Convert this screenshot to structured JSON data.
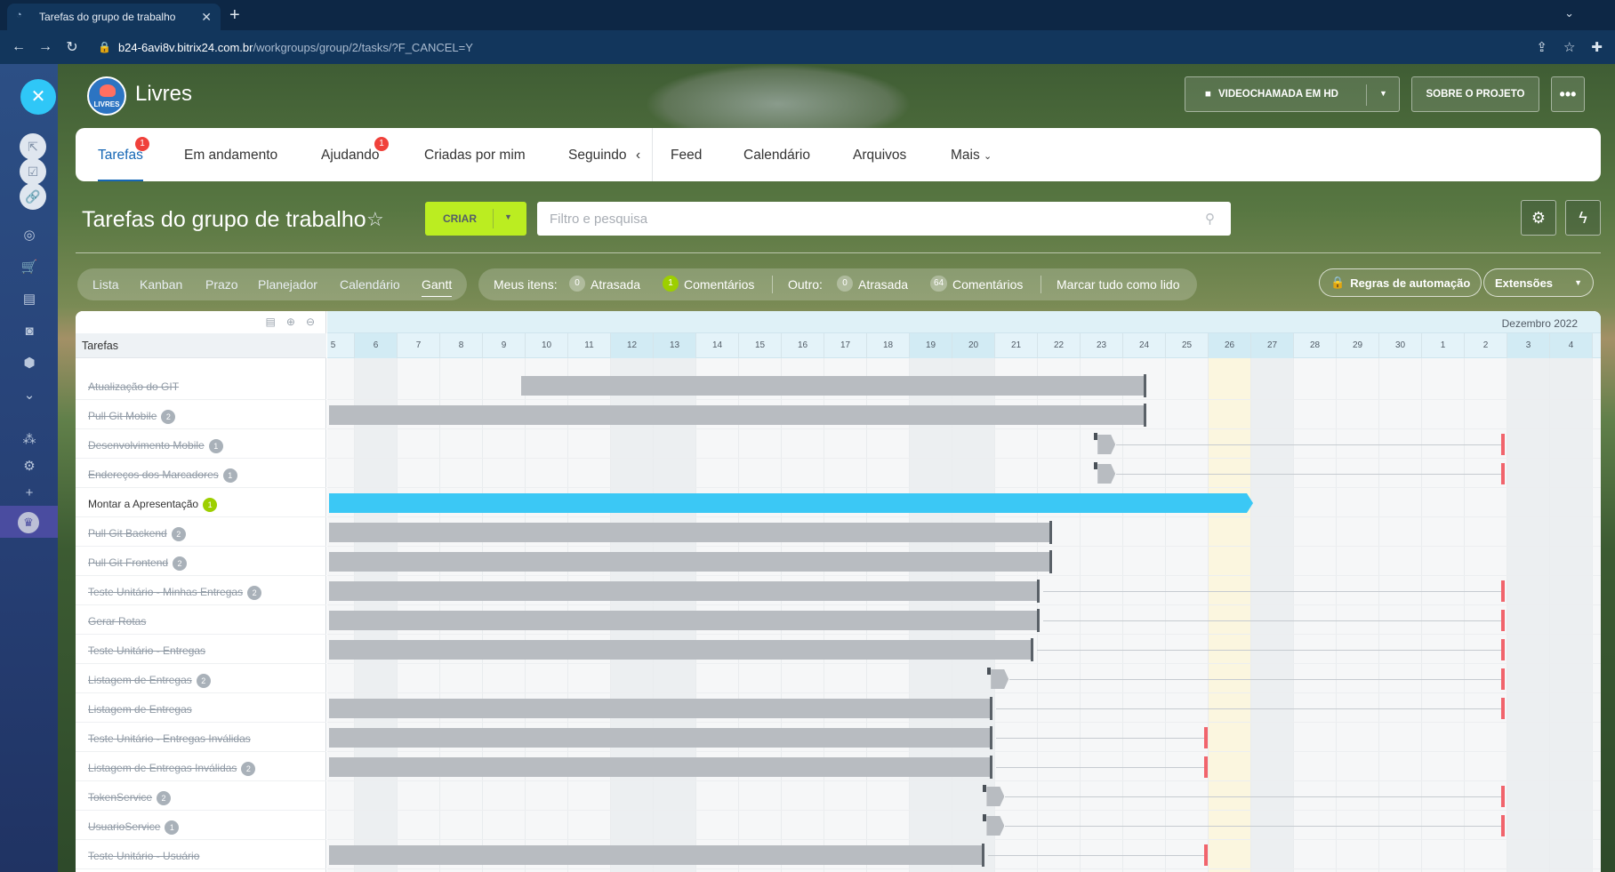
{
  "browser": {
    "tab_title": "Tarefas do grupo de trabalho",
    "url_host": "b24-6avi8v.bitrix24.com.br",
    "url_path": "/workgroups/group/2/tasks/?F_CANCEL=Y"
  },
  "group": {
    "logo_text": "LIVRES",
    "name": "Livres",
    "video_button": "VIDEOCHAMADA EM HD",
    "about_button": "SOBRE O PROJETO",
    "more_button": "•••"
  },
  "nav": {
    "items": [
      {
        "label": "Tarefas",
        "badge": "1"
      },
      {
        "label": "Em andamento"
      },
      {
        "label": "Ajudando",
        "badge": "1"
      },
      {
        "label": "Criadas por mim"
      },
      {
        "label": "Seguindo"
      },
      {
        "label": "Feed"
      },
      {
        "label": "Calendário"
      },
      {
        "label": "Arquivos"
      },
      {
        "label": "Mais"
      }
    ]
  },
  "toolbar": {
    "title": "Tarefas do grupo de trabalho",
    "create_label": "CRIAR",
    "search_placeholder": "Filtro e pesquisa"
  },
  "views": [
    "Lista",
    "Kanban",
    "Prazo",
    "Planejador",
    "Calendário",
    "Gantt"
  ],
  "counters": {
    "my_label": "Meus itens:",
    "my_overdue_count": "0",
    "overdue_label": "Atrasada",
    "my_comments_count": "1",
    "comments_label": "Comentários",
    "other_label": "Outro:",
    "other_overdue_count": "0",
    "other_overdue_label": "Atrasada",
    "other_comments_count": "64",
    "other_comments_label": "Comentários",
    "mark_all_read": "Marcar tudo como lido"
  },
  "right_buttons": {
    "automation": "Regras de automação",
    "extensions": "Extensões"
  },
  "gantt": {
    "column_header": "Tarefas",
    "month_label": "Dezembro 2022",
    "days": [
      "5",
      "6",
      "7",
      "8",
      "9",
      "10",
      "11",
      "12",
      "13",
      "14",
      "15",
      "16",
      "17",
      "18",
      "19",
      "20",
      "21",
      "22",
      "23",
      "24",
      "25",
      "26",
      "27",
      "28",
      "29",
      "30",
      "1",
      "2",
      "3",
      "4"
    ],
    "tasks": [
      {
        "name": "Atualização do GIT",
        "count": "",
        "done": true,
        "start_day": 9.4,
        "end_day": 24.0,
        "deadline_day": null
      },
      {
        "name": "Pull Git Mobile",
        "count": "2",
        "done": true,
        "start_day": 4.9,
        "end_day": 24.0,
        "deadline_day": null
      },
      {
        "name": "Desenvolvimento Mobile",
        "count": "1",
        "done": true,
        "start_day": 22.9,
        "end_day": 23.2,
        "deadline_day": 2.35
      },
      {
        "name": "Endereços dos Marcadores",
        "count": "1",
        "done": true,
        "start_day": 22.9,
        "end_day": 23.2,
        "deadline_day": 2.35
      },
      {
        "name": "Montar a Apresentação",
        "count": "1",
        "done": false,
        "start_day": 4.9,
        "end_day": 26.4,
        "deadline_day": null
      },
      {
        "name": "Pull Git Backend",
        "count": "2",
        "done": true,
        "start_day": 4.9,
        "end_day": 21.8,
        "deadline_day": null
      },
      {
        "name": "Pull Git Frontend",
        "count": "2",
        "done": true,
        "start_day": 4.9,
        "end_day": 21.8,
        "deadline_day": null
      },
      {
        "name": "Teste Unitário - Minhas Entregas",
        "count": "2",
        "done": true,
        "start_day": 4.9,
        "end_day": 21.5,
        "deadline_day": 2.35
      },
      {
        "name": "Gerar Rotas",
        "count": "",
        "done": true,
        "start_day": 4.9,
        "end_day": 21.5,
        "deadline_day": 2.35
      },
      {
        "name": "Teste Unitário - Entregas",
        "count": "",
        "done": true,
        "start_day": 4.9,
        "end_day": 21.35,
        "deadline_day": 2.35
      },
      {
        "name": "Listagem de Entregas",
        "count": "2",
        "done": true,
        "start_day": 20.4,
        "end_day": 20.7,
        "deadline_day": 2.35
      },
      {
        "name": "Listagem de Entregas",
        "count": "",
        "done": true,
        "start_day": 4.9,
        "end_day": 20.4,
        "deadline_day": 2.35
      },
      {
        "name": "Teste Unitário - Entregas Inválidas",
        "count": "",
        "done": true,
        "start_day": 4.9,
        "end_day": 20.4,
        "deadline_day": 25.4
      },
      {
        "name": "Listagem de Entregas Inválidas",
        "count": "2",
        "done": true,
        "start_day": 4.9,
        "end_day": 20.4,
        "deadline_day": 25.4
      },
      {
        "name": "TokenService",
        "count": "2",
        "done": true,
        "start_day": 20.3,
        "end_day": 20.6,
        "deadline_day": 2.35
      },
      {
        "name": "UsuarioService",
        "count": "1",
        "done": true,
        "start_day": 20.3,
        "end_day": 20.6,
        "deadline_day": 2.35
      },
      {
        "name": "Teste Unitário - Usuário",
        "count": "",
        "done": true,
        "start_day": 4.9,
        "end_day": 20.2,
        "deadline_day": 25.4
      }
    ]
  }
}
